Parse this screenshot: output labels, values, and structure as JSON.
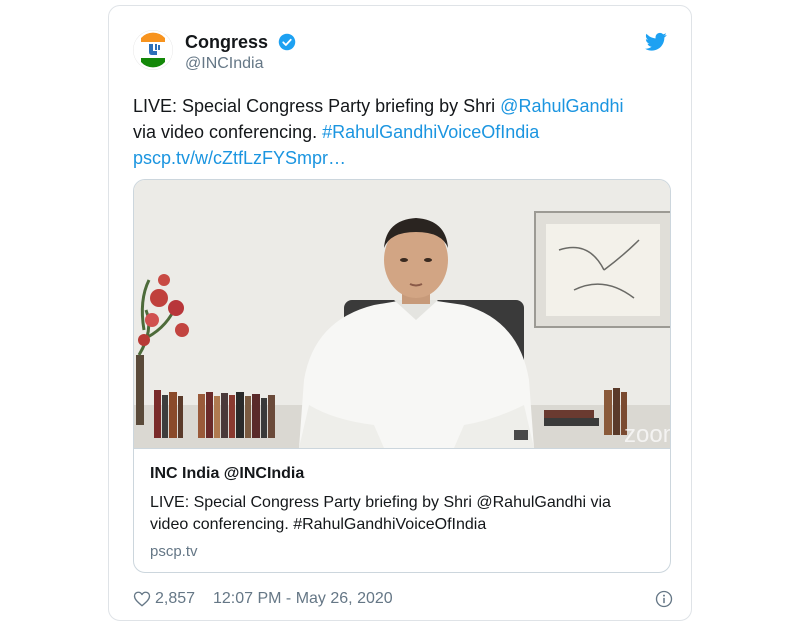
{
  "tweet": {
    "author": {
      "name": "Congress",
      "handle": "@INCIndia"
    },
    "text": {
      "part1": "LIVE: Special Congress Party briefing by Shri ",
      "mention": "@RahulGandhi",
      "part2": " via video conferencing. ",
      "hashtag": "#RahulGandhiVoiceOfIndia",
      "url": "pscp.tv/w/cZtfLzFYSmpr…"
    },
    "card": {
      "title": "INC India @INCIndia",
      "description": "LIVE: Special Congress Party briefing by Shri @RahulGandhi via video conferencing. #RahulGandhiVoiceOfIndia",
      "domain": "pscp.tv",
      "watermark": "zoom"
    },
    "footer": {
      "likes": "2,857",
      "timestamp": "12:07 PM - May 26, 2020"
    },
    "icons": [
      "verified-icon",
      "twitter-bird-icon",
      "heart-icon",
      "info-icon"
    ],
    "colors": {
      "link": "#1b95e0",
      "verified": "#1da1f2",
      "secondary_text": "#657786"
    }
  }
}
